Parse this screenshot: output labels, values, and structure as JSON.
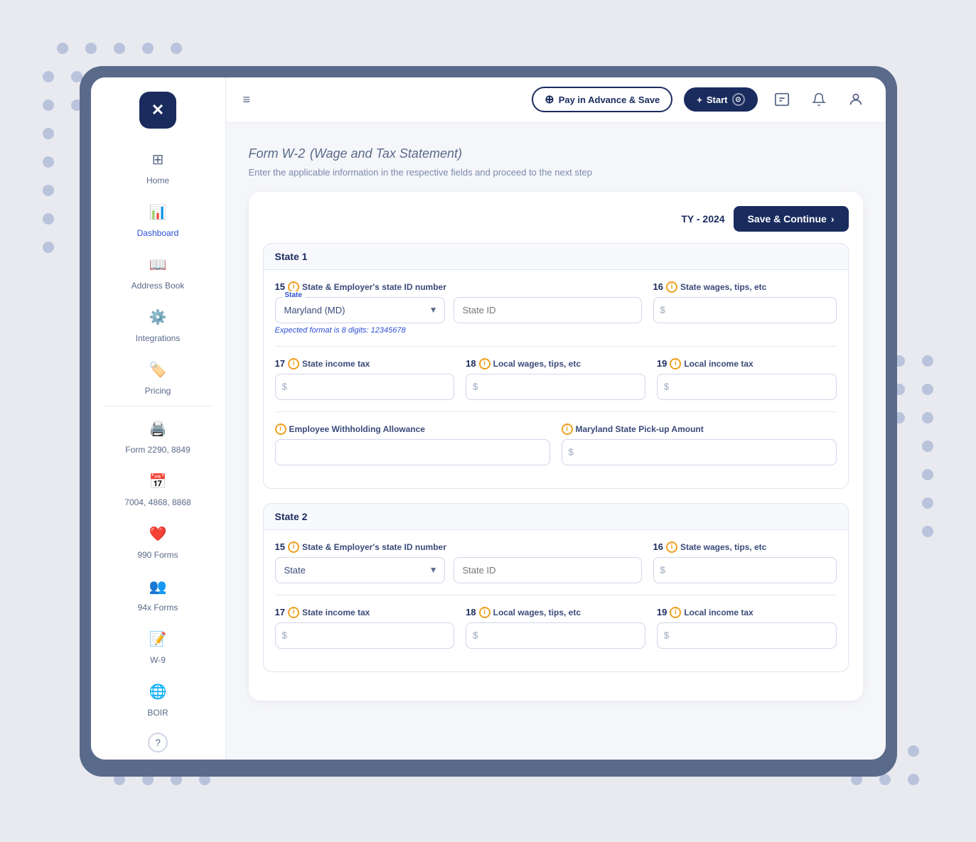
{
  "app": {
    "logo_symbol": "✕",
    "sidebar_toggle_icon": "≡"
  },
  "header": {
    "pay_advance_label": "Pay in Advance & Save",
    "start_label": "Start",
    "start_icon": "+"
  },
  "page": {
    "title": "Form W-2",
    "title_subtitle": "(Wage and Tax Statement)",
    "subtitle": "Enter the applicable information in the respective fields and proceed to the next step"
  },
  "form": {
    "ty_label": "TY - 2024",
    "save_continue_label": "Save & Continue",
    "states": [
      {
        "id": "state1",
        "section_label": "State 1",
        "field15_num": "15",
        "field15_label": "State & Employer's state ID number",
        "state_select_label": "State",
        "state_select_value": "Maryland (MD)",
        "state_id_placeholder": "State ID",
        "format_hint": "Expected format is 8 digits: 12345678",
        "field16_num": "16",
        "field16_label": "State wages, tips, etc",
        "field17_num": "17",
        "field17_label": "State income tax",
        "field18_num": "18",
        "field18_label": "Local wages, tips, etc",
        "field19_num": "19",
        "field19_label": "Local income tax",
        "extra_field1_label": "Employee Withholding Allowance",
        "extra_field2_label": "Maryland State Pick-up Amount",
        "dollar_symbol": "$",
        "info_icon_label": "i"
      },
      {
        "id": "state2",
        "section_label": "State 2",
        "field15_num": "15",
        "field15_label": "State & Employer's state ID number",
        "state_select_label": "State",
        "state_select_value": "",
        "state_select_placeholder": "State",
        "state_id_placeholder": "State ID",
        "format_hint": "",
        "field16_num": "16",
        "field16_label": "State wages, tips, etc",
        "field17_num": "17",
        "field17_label": "State income tax",
        "field18_num": "18",
        "field18_label": "Local wages, tips, etc",
        "field19_num": "19",
        "field19_label": "Local income tax",
        "dollar_symbol": "$",
        "info_icon_label": "i"
      }
    ]
  },
  "sidebar": {
    "items": [
      {
        "id": "home",
        "label": "Home",
        "icon": "⊞"
      },
      {
        "id": "dashboard",
        "label": "Dashboard",
        "icon": "📊"
      },
      {
        "id": "address-book",
        "label": "Address Book",
        "icon": "📖"
      },
      {
        "id": "integrations",
        "label": "Integrations",
        "icon": "⚙️"
      },
      {
        "id": "pricing",
        "label": "Pricing",
        "icon": "🏷️"
      },
      {
        "id": "form-2290",
        "label": "Form 2290, 8849",
        "icon": "🖨️"
      },
      {
        "id": "form-7004",
        "label": "7004, 4868, 8868",
        "icon": "📅"
      },
      {
        "id": "form-990",
        "label": "990 Forms",
        "icon": "❤️"
      },
      {
        "id": "form-94x",
        "label": "94x Forms",
        "icon": "👥"
      },
      {
        "id": "w-9",
        "label": "W-9",
        "icon": "📝"
      },
      {
        "id": "boir",
        "label": "BOIR",
        "icon": "🌐"
      }
    ],
    "help_icon": "?"
  }
}
